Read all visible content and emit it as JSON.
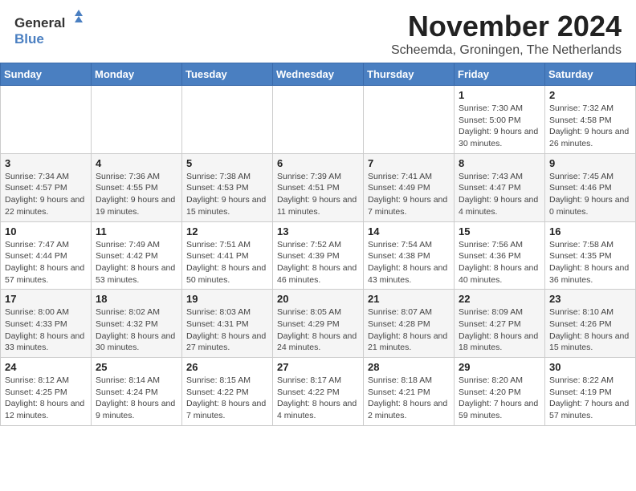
{
  "header": {
    "logo_general": "General",
    "logo_blue": "Blue",
    "month": "November 2024",
    "location": "Scheemda, Groningen, The Netherlands"
  },
  "weekdays": [
    "Sunday",
    "Monday",
    "Tuesday",
    "Wednesday",
    "Thursday",
    "Friday",
    "Saturday"
  ],
  "weeks": [
    [
      {
        "day": "",
        "info": ""
      },
      {
        "day": "",
        "info": ""
      },
      {
        "day": "",
        "info": ""
      },
      {
        "day": "",
        "info": ""
      },
      {
        "day": "",
        "info": ""
      },
      {
        "day": "1",
        "info": "Sunrise: 7:30 AM\nSunset: 5:00 PM\nDaylight: 9 hours and 30 minutes."
      },
      {
        "day": "2",
        "info": "Sunrise: 7:32 AM\nSunset: 4:58 PM\nDaylight: 9 hours and 26 minutes."
      }
    ],
    [
      {
        "day": "3",
        "info": "Sunrise: 7:34 AM\nSunset: 4:57 PM\nDaylight: 9 hours and 22 minutes."
      },
      {
        "day": "4",
        "info": "Sunrise: 7:36 AM\nSunset: 4:55 PM\nDaylight: 9 hours and 19 minutes."
      },
      {
        "day": "5",
        "info": "Sunrise: 7:38 AM\nSunset: 4:53 PM\nDaylight: 9 hours and 15 minutes."
      },
      {
        "day": "6",
        "info": "Sunrise: 7:39 AM\nSunset: 4:51 PM\nDaylight: 9 hours and 11 minutes."
      },
      {
        "day": "7",
        "info": "Sunrise: 7:41 AM\nSunset: 4:49 PM\nDaylight: 9 hours and 7 minutes."
      },
      {
        "day": "8",
        "info": "Sunrise: 7:43 AM\nSunset: 4:47 PM\nDaylight: 9 hours and 4 minutes."
      },
      {
        "day": "9",
        "info": "Sunrise: 7:45 AM\nSunset: 4:46 PM\nDaylight: 9 hours and 0 minutes."
      }
    ],
    [
      {
        "day": "10",
        "info": "Sunrise: 7:47 AM\nSunset: 4:44 PM\nDaylight: 8 hours and 57 minutes."
      },
      {
        "day": "11",
        "info": "Sunrise: 7:49 AM\nSunset: 4:42 PM\nDaylight: 8 hours and 53 minutes."
      },
      {
        "day": "12",
        "info": "Sunrise: 7:51 AM\nSunset: 4:41 PM\nDaylight: 8 hours and 50 minutes."
      },
      {
        "day": "13",
        "info": "Sunrise: 7:52 AM\nSunset: 4:39 PM\nDaylight: 8 hours and 46 minutes."
      },
      {
        "day": "14",
        "info": "Sunrise: 7:54 AM\nSunset: 4:38 PM\nDaylight: 8 hours and 43 minutes."
      },
      {
        "day": "15",
        "info": "Sunrise: 7:56 AM\nSunset: 4:36 PM\nDaylight: 8 hours and 40 minutes."
      },
      {
        "day": "16",
        "info": "Sunrise: 7:58 AM\nSunset: 4:35 PM\nDaylight: 8 hours and 36 minutes."
      }
    ],
    [
      {
        "day": "17",
        "info": "Sunrise: 8:00 AM\nSunset: 4:33 PM\nDaylight: 8 hours and 33 minutes."
      },
      {
        "day": "18",
        "info": "Sunrise: 8:02 AM\nSunset: 4:32 PM\nDaylight: 8 hours and 30 minutes."
      },
      {
        "day": "19",
        "info": "Sunrise: 8:03 AM\nSunset: 4:31 PM\nDaylight: 8 hours and 27 minutes."
      },
      {
        "day": "20",
        "info": "Sunrise: 8:05 AM\nSunset: 4:29 PM\nDaylight: 8 hours and 24 minutes."
      },
      {
        "day": "21",
        "info": "Sunrise: 8:07 AM\nSunset: 4:28 PM\nDaylight: 8 hours and 21 minutes."
      },
      {
        "day": "22",
        "info": "Sunrise: 8:09 AM\nSunset: 4:27 PM\nDaylight: 8 hours and 18 minutes."
      },
      {
        "day": "23",
        "info": "Sunrise: 8:10 AM\nSunset: 4:26 PM\nDaylight: 8 hours and 15 minutes."
      }
    ],
    [
      {
        "day": "24",
        "info": "Sunrise: 8:12 AM\nSunset: 4:25 PM\nDaylight: 8 hours and 12 minutes."
      },
      {
        "day": "25",
        "info": "Sunrise: 8:14 AM\nSunset: 4:24 PM\nDaylight: 8 hours and 9 minutes."
      },
      {
        "day": "26",
        "info": "Sunrise: 8:15 AM\nSunset: 4:22 PM\nDaylight: 8 hours and 7 minutes."
      },
      {
        "day": "27",
        "info": "Sunrise: 8:17 AM\nSunset: 4:22 PM\nDaylight: 8 hours and 4 minutes."
      },
      {
        "day": "28",
        "info": "Sunrise: 8:18 AM\nSunset: 4:21 PM\nDaylight: 8 hours and 2 minutes."
      },
      {
        "day": "29",
        "info": "Sunrise: 8:20 AM\nSunset: 4:20 PM\nDaylight: 7 hours and 59 minutes."
      },
      {
        "day": "30",
        "info": "Sunrise: 8:22 AM\nSunset: 4:19 PM\nDaylight: 7 hours and 57 minutes."
      }
    ]
  ]
}
